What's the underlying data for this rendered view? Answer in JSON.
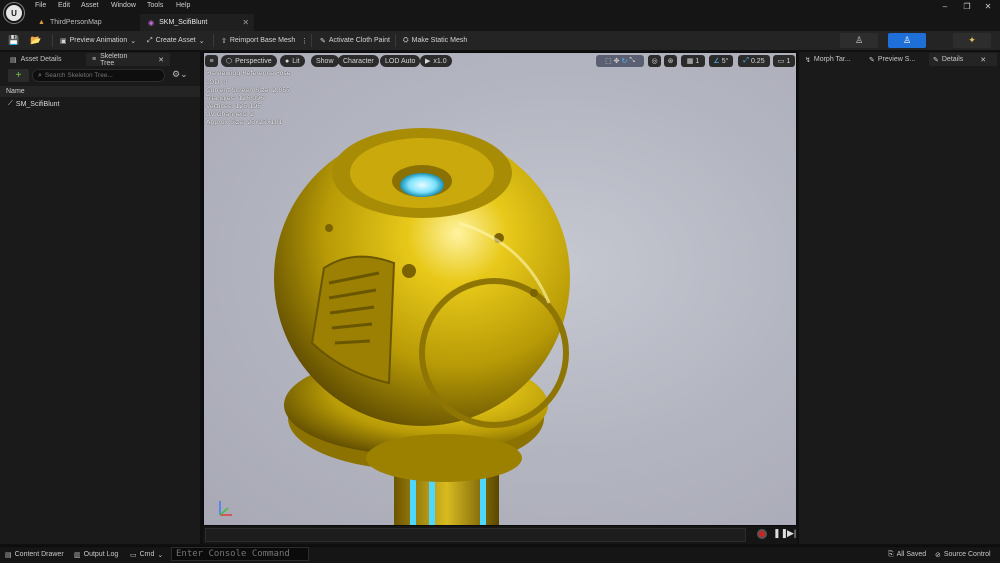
{
  "app": {
    "logo_text": "U"
  },
  "menu": [
    "File",
    "Edit",
    "Asset",
    "Window",
    "Tools",
    "Help"
  ],
  "tabs": [
    {
      "label": "ThirdPersonMap"
    },
    {
      "label": "SKM_ScifiBlunt"
    }
  ],
  "toolbar": {
    "preview_animation": "Preview Animation",
    "create_asset": "Create Asset",
    "reimport": "Reimport Base Mesh",
    "cloth_paint": "Activate Cloth Paint",
    "make_static": "Make Static Mesh"
  },
  "left_panel": {
    "tab_asset_details": "Asset Details",
    "tab_skeleton_tree": "Skeleton Tree",
    "search_placeholder": "Search Skeleton Tree...",
    "column_name": "Name",
    "tree_item": "SM_ScifiBlunt"
  },
  "viewport": {
    "perspective": "Perspective",
    "lit": "Lit",
    "show": "Show",
    "character": "Character",
    "lod": "LOD Auto",
    "speed": "x1.0",
    "grid_num": "1",
    "angle_num": "5°",
    "scale_num": "0.25",
    "cam_num": "1",
    "stats": [
      "Previewing Reference Pose",
      "LOD: 0",
      "Current Screen Size: 2.057",
      "Triangles: 126,096",
      "Vertices: 125,195",
      "UV Channels: 2",
      "Approx Size: 23x23x101"
    ]
  },
  "right_panel": {
    "tab_morph": "Morph Tar...",
    "tab_preview": "Preview S...",
    "tab_details": "Details"
  },
  "statusbar": {
    "content_drawer": "Content Drawer",
    "output_log": "Output Log",
    "cmd": "Cmd",
    "console_placeholder": "Enter Console Command",
    "all_saved": "All Saved",
    "source_control": "Source Control"
  },
  "colors": {
    "accent_blue": "#1f6fd9",
    "gold": "#c9a90c",
    "viewport_bg": "#b7b9c4"
  }
}
